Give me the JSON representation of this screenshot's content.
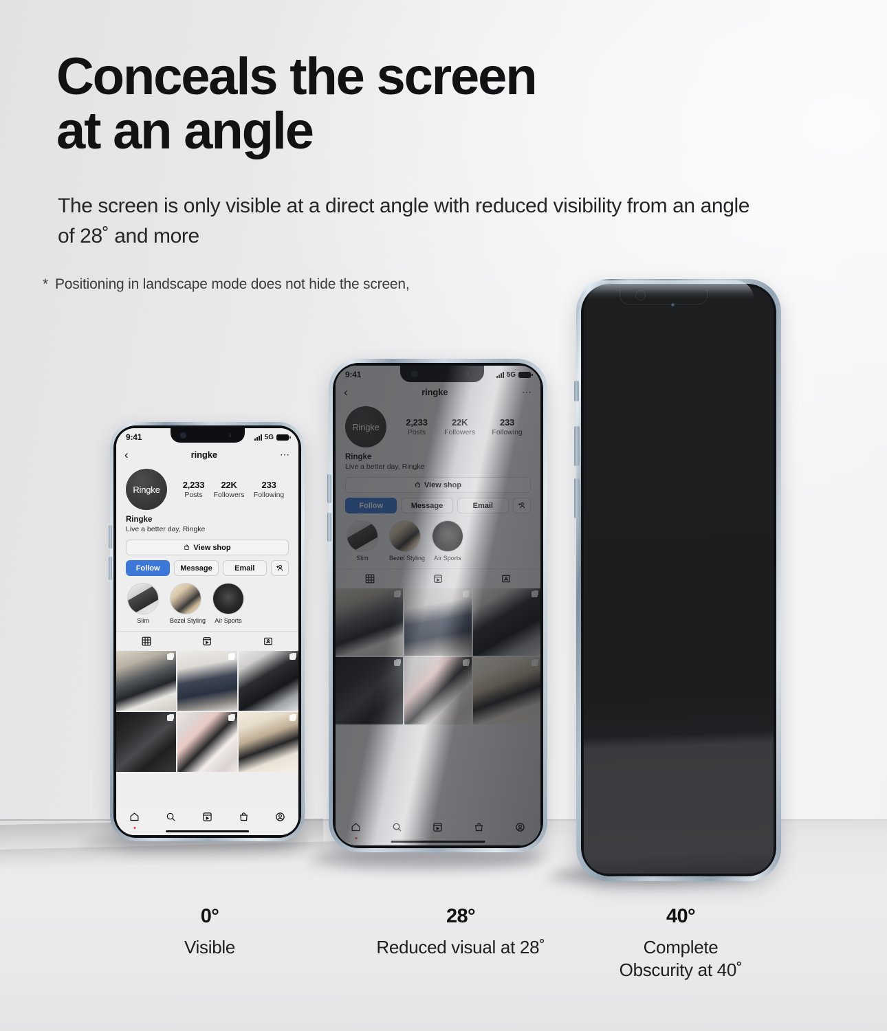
{
  "headline": "Conceals the screen\nat an angle",
  "subhead": "The screen is only visible at a direct angle with reduced visibility from an angle of 28˚ and more",
  "footnote": {
    "marker": "*",
    "text": "Positioning in landscape mode does not hide the screen,"
  },
  "phone_ui": {
    "status": {
      "time": "9:41",
      "network": "5G"
    },
    "navbar": {
      "back_icon": "chevron-left-icon",
      "username": "ringke",
      "more_icon": "more-horizontal-icon"
    },
    "profile": {
      "avatar_label": "Ringke",
      "stats": [
        {
          "num": "2,233",
          "label": "Posts"
        },
        {
          "num": "22K",
          "label": "Followers"
        },
        {
          "num": "233",
          "label": "Following"
        }
      ],
      "display_name": "Ringke",
      "bio": "Live a better day, Ringke"
    },
    "shop_button": {
      "icon": "shopping-bag-icon",
      "label": "View shop"
    },
    "actions": [
      {
        "label": "Follow",
        "primary": true
      },
      {
        "label": "Message",
        "primary": false
      },
      {
        "label": "Email",
        "primary": false
      }
    ],
    "add_person_icon": "add-person-icon",
    "highlights": [
      {
        "label": "Slim"
      },
      {
        "label": "Bezel Styling"
      },
      {
        "label": "Air Sports"
      }
    ],
    "tabs": [
      {
        "icon": "grid-icon",
        "active": true
      },
      {
        "icon": "reels-icon",
        "active": false
      },
      {
        "icon": "tagged-icon",
        "active": false
      }
    ],
    "grid_cells": [
      {
        "alt": "person tying shoe wearing smartwatch",
        "multi": true
      },
      {
        "alt": "woman with crossbody phone case",
        "multi": true
      },
      {
        "alt": "hand drawing on tablet with stylus",
        "multi": true
      },
      {
        "alt": "dark watch bands and cases",
        "multi": true
      },
      {
        "alt": "pastel phone cases laid in rows",
        "multi": true
      },
      {
        "alt": "bags and accessories on table",
        "multi": true
      }
    ],
    "bottom_nav": [
      {
        "icon": "home-icon",
        "badge": true
      },
      {
        "icon": "search-icon",
        "badge": false
      },
      {
        "icon": "reels-icon",
        "badge": false
      },
      {
        "icon": "shop-icon",
        "badge": false
      },
      {
        "icon": "profile-icon",
        "badge": false
      }
    ]
  },
  "captions": [
    {
      "degree": "0°",
      "desc": "Visible"
    },
    {
      "degree": "28°",
      "desc": "Reduced visual at 28˚"
    },
    {
      "degree": "40°",
      "desc": "Complete\nObscurity at 40˚"
    }
  ],
  "colors": {
    "background": "#eeeeef",
    "text_primary": "#111214",
    "accent_blue": "#3c78d8",
    "phone_frame": "#b3c2cf",
    "dark_screen": "#1d1e20",
    "badge_red": "#e03b2e"
  }
}
